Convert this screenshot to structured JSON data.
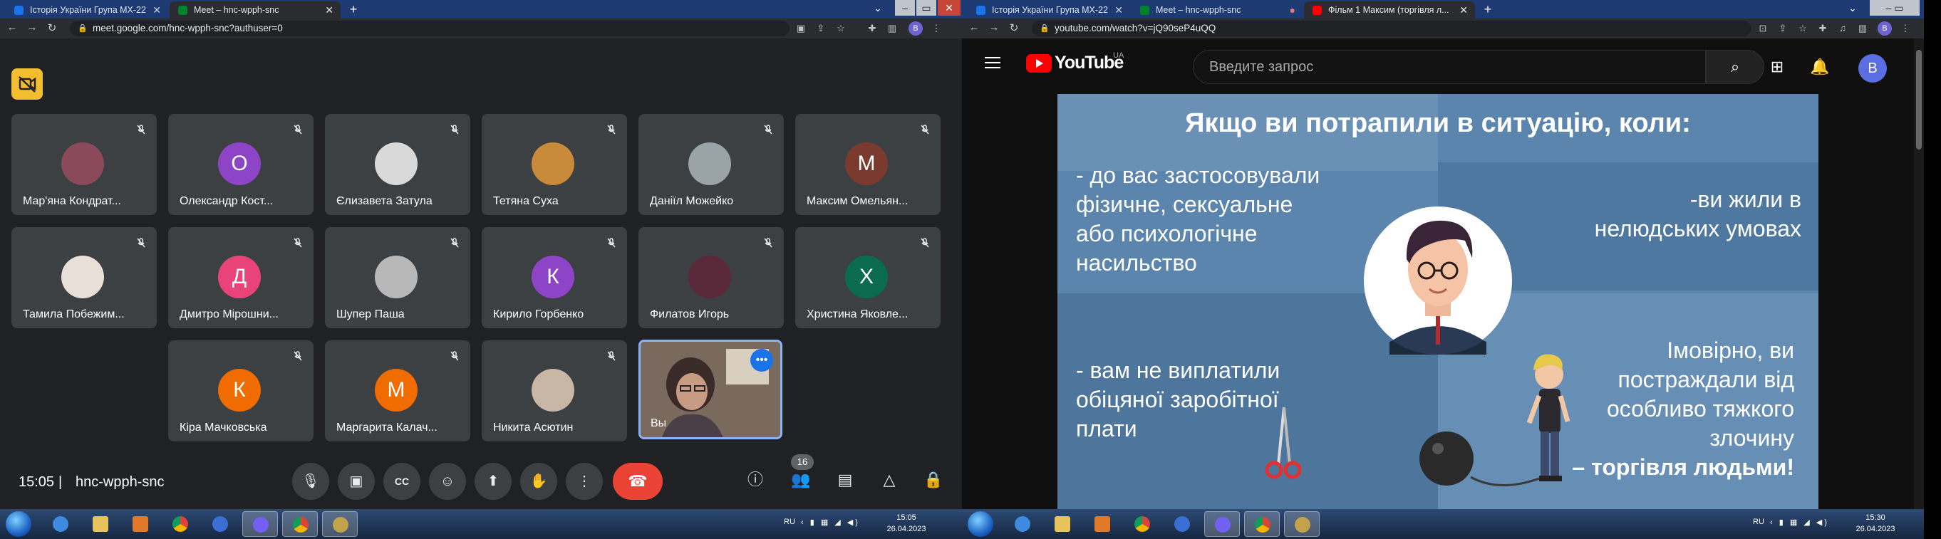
{
  "left_window": {
    "tabs": [
      {
        "label": "Історія України Група МХ-22",
        "active": false,
        "favicon": "classroom-icon",
        "color": "#1a73e8"
      },
      {
        "label": "Meet – hnc-wpph-snc",
        "active": true,
        "favicon": "meet-icon",
        "color": "#00832d"
      }
    ],
    "url": "meet.google.com/hnc-wpph-snc?authuser=0",
    "profile_letter": "B",
    "participants": [
      {
        "name": "Мар'яна Кондрат...",
        "avatar_type": "photo",
        "avatar_color": "#8a4a5a"
      },
      {
        "name": "Олександр Кост...",
        "avatar_type": "letter",
        "letter": "О",
        "avatar_color": "#8e44c6"
      },
      {
        "name": "Єлизавета Затула",
        "avatar_type": "photo",
        "avatar_color": "#d9d9d9"
      },
      {
        "name": "Тетяна Суха",
        "avatar_type": "photo",
        "avatar_color": "#c98a3a"
      },
      {
        "name": "Даніїл Можейко",
        "avatar_type": "photo",
        "avatar_color": "#9aa4a8"
      },
      {
        "name": "Максим Омельян...",
        "avatar_type": "letter",
        "letter": "М",
        "avatar_color": "#7a3b2e"
      },
      {
        "name": "Тамила Побежим...",
        "avatar_type": "photo",
        "avatar_color": "#e8e0d8"
      },
      {
        "name": "Дмитро Мірошни...",
        "avatar_type": "letter",
        "letter": "Д",
        "avatar_color": "#e8447a"
      },
      {
        "name": "Шупер Паша",
        "avatar_type": "photo",
        "avatar_color": "#b8b8b8"
      },
      {
        "name": "Кирило Горбенко",
        "avatar_type": "letter",
        "letter": "К",
        "avatar_color": "#8e44c6"
      },
      {
        "name": "Филатов Игорь",
        "avatar_type": "photo",
        "avatar_color": "#5a2a3a"
      },
      {
        "name": "Христина Яковле...",
        "avatar_type": "letter",
        "letter": "Х",
        "avatar_color": "#0b6b4f"
      },
      {
        "name": "Кіра Мачковська",
        "avatar_type": "letter",
        "letter": "К",
        "avatar_color": "#f06c00"
      },
      {
        "name": "Маргарита Калач...",
        "avatar_type": "letter",
        "letter": "М",
        "avatar_color": "#f06c00"
      },
      {
        "name": "Никита Асютин",
        "avatar_type": "photo",
        "avatar_color": "#c9b7a6"
      }
    ],
    "self_tile": {
      "name": "Вы",
      "more_label": "•••"
    },
    "time": "15:05",
    "meeting_code": "hnc-wpph-snc",
    "participants_count": "16",
    "taskbar": {
      "lang": "RU",
      "time": "15:05",
      "date": "26.04.2023"
    }
  },
  "right_window": {
    "tabs": [
      {
        "label": "Історія України Група МХ-22",
        "active": false,
        "favicon": "classroom-icon",
        "color": "#1a73e8"
      },
      {
        "label": "Meet – hnc-wpph-snc",
        "active": false,
        "favicon": "meet-icon",
        "color": "#00832d"
      },
      {
        "label": "Фільм 1 Максим (торгівля л...",
        "active": true,
        "favicon": "youtube-icon",
        "color": "#ff0000"
      }
    ],
    "url": "youtube.com/watch?v=jQ90seP4uQQ",
    "profile_letter": "B",
    "youtube": {
      "logo_text": "YouTube",
      "region": "UA",
      "search_placeholder": "Введите запрос",
      "avatar_letter": "B"
    },
    "video": {
      "heading": "Якщо ви потрапили в ситуацію, коли:",
      "top_left": [
        "- до вас застосовували",
        "фізичне, сексуальне",
        "або психологічне",
        "насильство"
      ],
      "top_right": [
        "-ви жили в",
        "нелюдських умовах"
      ],
      "bottom_left": [
        "- вам не виплатили",
        "обіцяної заробітної",
        "плати"
      ],
      "bottom_right": [
        "Імовірно, ви",
        "постраждали від",
        "особливо тяжкого",
        "злочину"
      ],
      "bottom_right_bold": "– торгівля людьми!",
      "bg_color": "#5c85ad"
    },
    "taskbar": {
      "lang": "RU",
      "time": "15:30",
      "date": "26.04.2023"
    }
  }
}
